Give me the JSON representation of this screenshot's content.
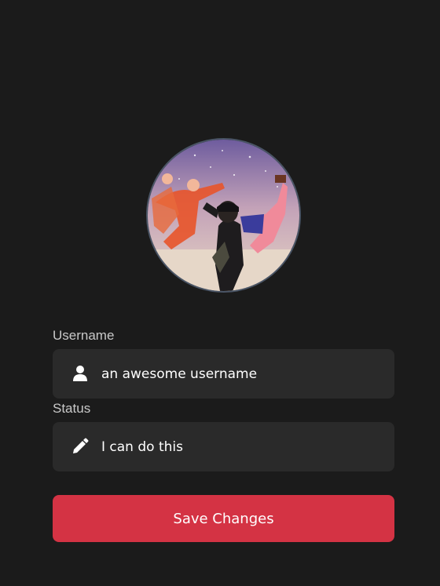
{
  "profile": {
    "avatar_alt": "profile picture"
  },
  "username": {
    "label": "Username",
    "value": "an awesome username",
    "icon": "user-icon"
  },
  "status": {
    "label": "Status",
    "value": "I can do this",
    "icon": "pencil-icon"
  },
  "actions": {
    "save_label": "Save Changes"
  },
  "colors": {
    "background": "#1b1b1b",
    "field_background": "#2a2a2a",
    "accent": "#d43344",
    "label_text": "#c9c9c9"
  }
}
